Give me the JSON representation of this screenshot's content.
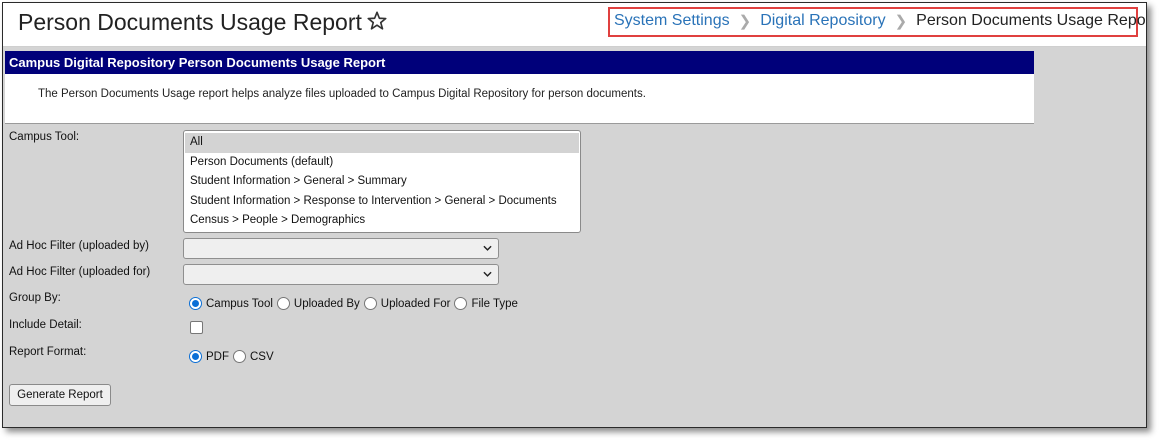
{
  "header": {
    "title": "Person Documents Usage Report",
    "favorite_icon": "star-icon",
    "breadcrumb": [
      {
        "label": "System Settings",
        "link": true
      },
      {
        "label": "Digital Repository",
        "link": true
      },
      {
        "label": "Person Documents Usage Report",
        "link": false
      }
    ],
    "breadcrumb_separator_icon": "chevron-right-icon",
    "highlight_color": "#e0403f"
  },
  "panel": {
    "title": "Campus Digital Repository Person Documents Usage Report",
    "description": "The Person Documents Usage report helps analyze files uploaded to Campus Digital Repository for person documents.",
    "header_color": "#00007a"
  },
  "form": {
    "campus_tool": {
      "label": "Campus Tool:",
      "options": [
        "All",
        "Person Documents (default)",
        "Student Information > General > Summary",
        "Student Information > Response to Intervention > General > Documents",
        "Census > People > Demographics"
      ],
      "selected": "All"
    },
    "adhoc_uploaded_by": {
      "label": "Ad Hoc Filter (uploaded by)",
      "value": ""
    },
    "adhoc_uploaded_for": {
      "label": "Ad Hoc Filter (uploaded for)",
      "value": ""
    },
    "group_by": {
      "label": "Group By:",
      "options": [
        "Campus Tool",
        "Uploaded By",
        "Uploaded For",
        "File Type"
      ],
      "selected": "Campus Tool"
    },
    "include_detail": {
      "label": "Include Detail:",
      "checked": false
    },
    "report_format": {
      "label": "Report Format:",
      "options": [
        "PDF",
        "CSV"
      ],
      "selected": "PDF"
    },
    "generate_button": "Generate Report"
  }
}
